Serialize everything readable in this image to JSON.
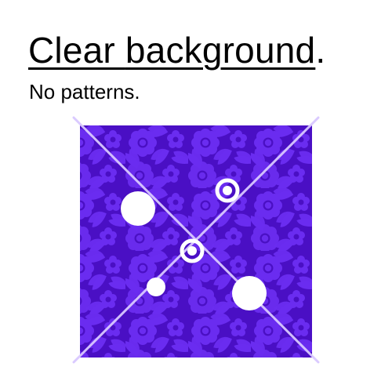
{
  "heading": {
    "text_a": "Clear ",
    "text_b": "background",
    "text_c": "."
  },
  "subheading": {
    "text": "No patterns."
  },
  "colors": {
    "panel_fill": "#4a0fc4",
    "pattern_fill": "#6a2cf0",
    "cross_lines": "#d9c8ff",
    "markers": "#ffffff"
  },
  "icons": {
    "marker_style_ring": "ring-marker-icon",
    "marker_style_dot": "dot-marker-icon"
  }
}
